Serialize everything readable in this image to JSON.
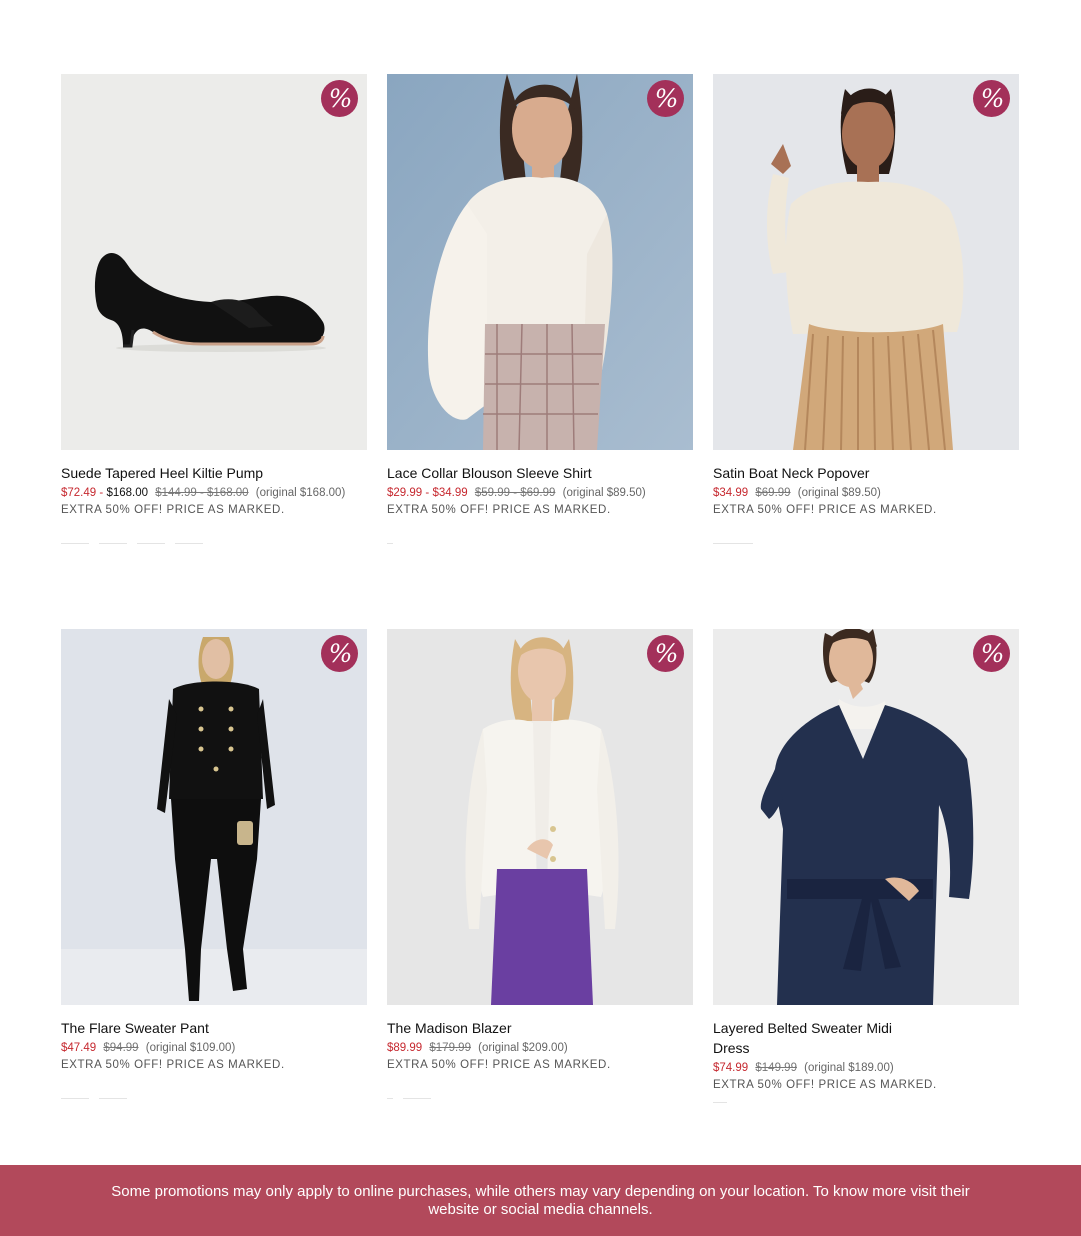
{
  "products": [
    {
      "name": "Suede Tapered Heel Kiltie Pump",
      "sale_price": "$72.49",
      "dash": "-",
      "regular_price": "$168.00",
      "was_price": "$144.99 - $168.00",
      "original_price": "(original $168.00)",
      "promo": "EXTRA 50% OFF! PRICE AS MARKED.",
      "badge": "%",
      "image": "black-suede-kitten-heel-pump"
    },
    {
      "name": "Lace Collar Blouson Sleeve Shirt",
      "sale_price": "$29.99",
      "dash": "-",
      "regular_price": "$34.99",
      "was_price": "$59.99 - $69.99",
      "original_price": "(original $89.50)",
      "promo": "EXTRA 50% OFF! PRICE AS MARKED.",
      "badge": "%",
      "image": "white-blouse-plaid-pants"
    },
    {
      "name": "Satin Boat Neck Popover",
      "sale_price": "$34.99",
      "was_price": "$69.99",
      "original_price": "(original $89.50)",
      "promo": "EXTRA 50% OFF! PRICE AS MARKED.",
      "badge": "%",
      "image": "ivory-satin-top-pleated-skirt"
    },
    {
      "name": "The Flare Sweater Pant",
      "sale_price": "$47.49",
      "was_price": "$94.99",
      "original_price": "(original $109.00)",
      "promo": "EXTRA 50% OFF! PRICE AS MARKED.",
      "badge": "%",
      "image": "black-knit-set"
    },
    {
      "name": "The Madison Blazer",
      "sale_price": "$89.99",
      "was_price": "$179.99",
      "original_price": "(original $209.00)",
      "promo": "EXTRA 50% OFF! PRICE AS MARKED.",
      "badge": "%",
      "image": "white-blazer-purple-skirt"
    },
    {
      "name": "Layered Belted Sweater Midi Dress",
      "sale_price": "$74.99",
      "was_price": "$149.99",
      "original_price": "(original $189.00)",
      "promo": "EXTRA 50% OFF! PRICE AS MARKED.",
      "badge": "%",
      "image": "navy-belted-sweater-dress"
    }
  ],
  "banner": {
    "text": "Some promotions may only apply to online purchases, while others may vary depending on your location. To know more visit their website or social media channels."
  },
  "colors": {
    "sale": "#c6282f",
    "badge": "#a3305a",
    "banner": "#b2495b"
  }
}
